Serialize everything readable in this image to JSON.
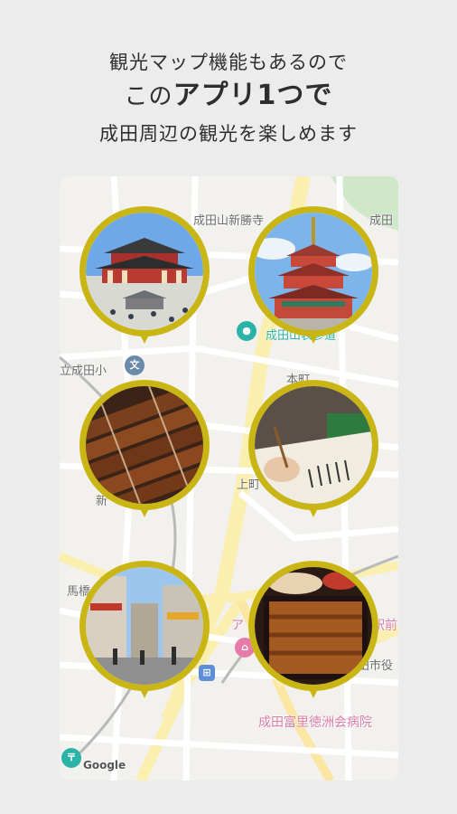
{
  "headline": {
    "line1": "観光マップ機能もあるので",
    "line2_prefix": "この",
    "line2_bold": "アプリ1つで",
    "line3": "成田周辺の観光を楽しめます"
  },
  "map": {
    "labels": {
      "shinshoji": "成田山新勝寺",
      "narita_top_right": "成田",
      "omotesando": "成田山表参道",
      "school": "立成田小",
      "honcho": "本町",
      "kami": "上町",
      "shin": "新",
      "uma": "馬橋",
      "a_label": "ア",
      "station": "駅前",
      "city": "田市役",
      "hospital": "成田富里徳洲会病院",
      "google": "Google"
    },
    "icons": {
      "school_icon": "文",
      "attraction_icon": "●",
      "hotel_icon": "⌂",
      "station_icon": "⊞",
      "post_icon": "〒"
    }
  },
  "pins": [
    {
      "name": "temple-hall",
      "subject": "great-hall-photo"
    },
    {
      "name": "pagoda",
      "subject": "pagoda-photo"
    },
    {
      "name": "eel-grill",
      "subject": "grilled-eel-photo"
    },
    {
      "name": "calligraphy",
      "subject": "calligraphy-photo"
    },
    {
      "name": "street",
      "subject": "shopping-street-photo"
    },
    {
      "name": "unaju",
      "subject": "unaju-box-photo"
    }
  ],
  "colors": {
    "pin_frame": "#c9b513",
    "background": "#ececec"
  }
}
